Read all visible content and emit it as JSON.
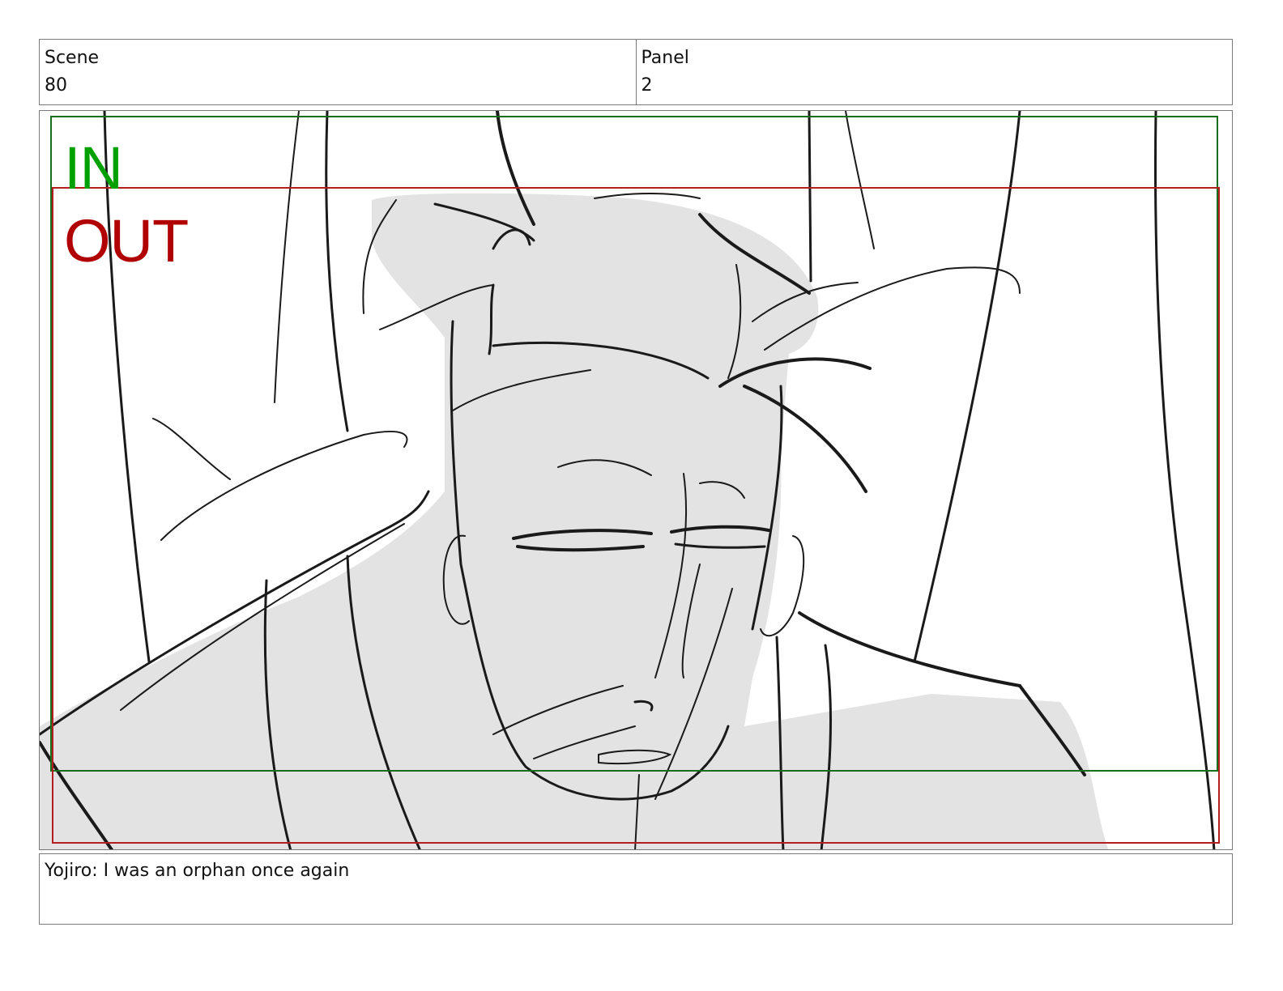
{
  "header": {
    "scene_label": "Scene",
    "scene_value": "80",
    "panel_label": "Panel",
    "panel_value": "2"
  },
  "frame": {
    "in_label": "IN",
    "out_label": "OUT",
    "in_color": "#00a000",
    "out_color": "#b00000",
    "in_box_color": "#1a6e1a",
    "out_box_color": "#b41e1e"
  },
  "dialogue": {
    "text": "Yojiro: I was an orphan once again"
  }
}
